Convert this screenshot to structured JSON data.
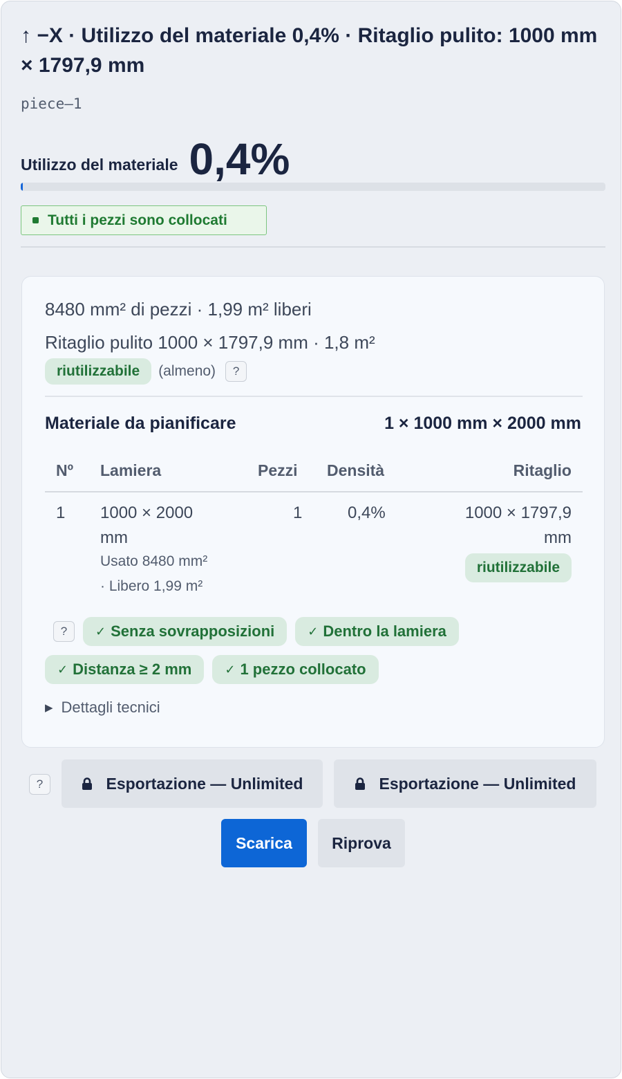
{
  "header": {
    "title": "↑ −X · Utilizzo del materiale 0,4% · Ritaglio pulito: 1000 mm × 1797,9 mm",
    "piece_id": "piece–1"
  },
  "utilization": {
    "label": "Utilizzo del materiale",
    "value": "0,4%",
    "progress_percent": 0.4,
    "status": "Tutti i pezzi sono collocati"
  },
  "summary": {
    "pieces_area": "8480 mm² di pezzi · 1,99 m² liberi",
    "clean_offcut": "Ritaglio pulito 1000 × 1797,9 mm · 1,8 m²",
    "reusable_badge": "riutilizzabile",
    "reusable_note": "(almeno)",
    "help": "?"
  },
  "material": {
    "label": "Materiale da pianificare",
    "value": "1 × 1000 mm × 2000 mm"
  },
  "table": {
    "headers": [
      "Nº",
      "Lamiera",
      "Pezzi",
      "Densità",
      "Ritaglio"
    ],
    "rows": [
      {
        "num": "1",
        "sheet_line1": "1000 × 2000",
        "sheet_line2": "mm",
        "used": "Usato 8480 mm²",
        "free": "· Libero 1,99 m²",
        "pieces": "1",
        "density": "0,4%",
        "offcut_line1": "1000 × 1797,9",
        "offcut_line2": "mm",
        "offcut_badge": "riutilizzabile"
      }
    ]
  },
  "checks": {
    "help": "?",
    "items": [
      "Senza sovrapposizioni",
      "Dentro la lamiera",
      "Distanza ≥ 2 mm",
      "1 pezzo collocato"
    ]
  },
  "details_label": "Dettagli tecnici",
  "actions": {
    "help": "?",
    "export1": "Esportazione — Unlimited",
    "export2": "Esportazione — Unlimited",
    "download": "Scarica",
    "retry": "Riprova"
  },
  "colors": {
    "accent": "#0d66d6",
    "success": "#1f7a32",
    "text": "#1b2540"
  }
}
